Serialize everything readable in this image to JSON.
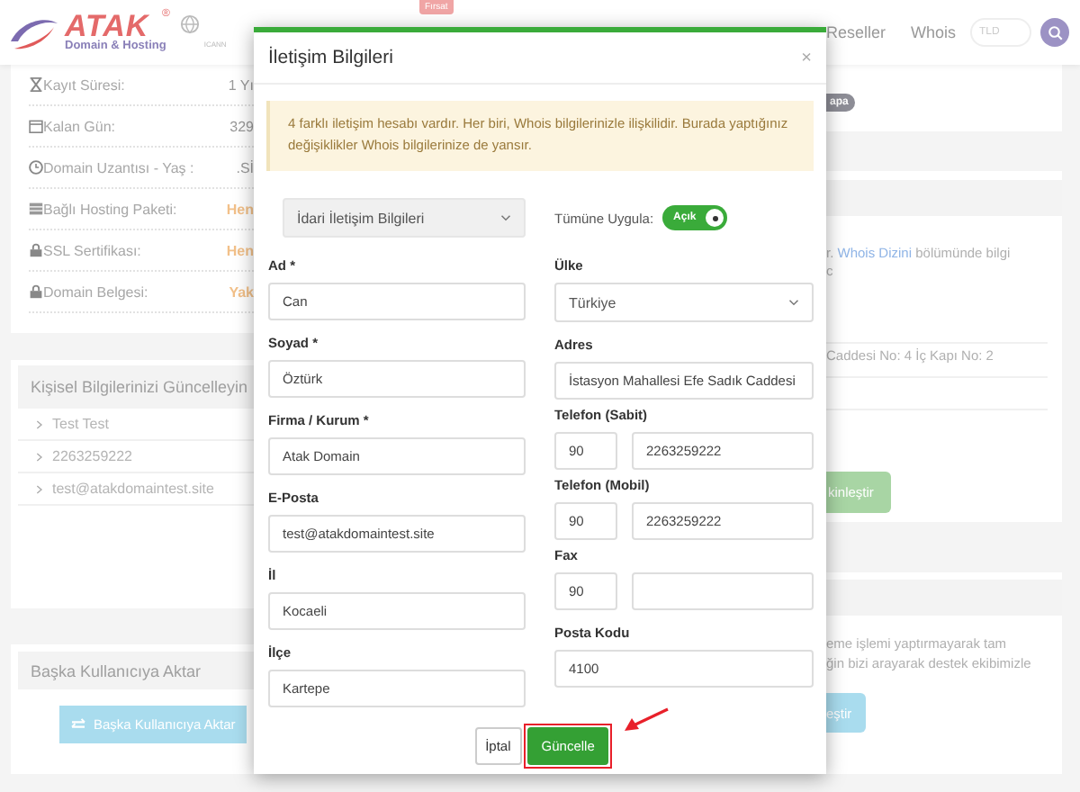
{
  "header": {
    "logo": {
      "brand": "ATAK",
      "registered": "®",
      "subtitle": "Domain & Hosting",
      "mark": "ICANN"
    },
    "promo_badge": "Fırsat",
    "nav": [
      "Reseller",
      "Whois"
    ],
    "tld_search": {
      "placeholder": "TLD"
    }
  },
  "domain_details": [
    {
      "kind": "hourglass",
      "label": "Kayıt Süresi:",
      "value": "1 Yı",
      "highlighted": false
    },
    {
      "kind": "calendar",
      "label": "Kalan Gün:",
      "value": "329",
      "highlighted": false
    },
    {
      "kind": "clock",
      "label": "Domain Uzantısı - Yaş :",
      "value": ".Sİ",
      "highlighted": false
    },
    {
      "kind": "server",
      "label": "Bağlı Hosting Paketi:",
      "value": "Hen",
      "highlighted": true
    },
    {
      "kind": "lock",
      "label": "SSL Sertifikası:",
      "value": "Hen",
      "highlighted": true
    },
    {
      "kind": "lock",
      "label": "Domain Belgesi:",
      "value": "Yak",
      "highlighted": true
    }
  ],
  "personal_info": {
    "title": "Kişisel Bilgilerinizi Güncelleyin",
    "items": [
      "Test Test",
      "2263259222",
      "test@atakdomaintest.site"
    ]
  },
  "transfer": {
    "title": "Başka Kullanıcıya Aktar",
    "button": "Başka Kullanıcıya Aktar"
  },
  "right_status_badge": "apa",
  "whois_panel": {
    "text_before": "r.",
    "link": "Whois Dizini",
    "text_after": "bölümünde bilgi",
    "line_2": "c",
    "address": "Caddesi No: 4 İç Kapı No: 2",
    "button": "kinleştir"
  },
  "support_panel": {
    "lines": [
      "eme işlemi yaptırmayarak tam",
      "ğin bizi arayarak destek ekibimizle"
    ],
    "button": "eştir"
  },
  "modal": {
    "title": "İletişim Bilgileri",
    "close": "×",
    "notice": "4 farklı iletişim hesabı vardır. Her biri, Whois bilgilerinizle ilişkilidir. Burada yaptığınız değişiklikler Whois bilgilerinize de yansır.",
    "contact_select": "İdari İletişim Bilgileri",
    "apply_all": {
      "label": "Tümüne Uygula:",
      "on": true,
      "state_text": "Açık"
    },
    "left_fields": [
      {
        "label": "Ad *",
        "kind": "text",
        "value": "Can"
      },
      {
        "label": "Soyad *",
        "kind": "text",
        "value": "Öztürk"
      },
      {
        "label": "Firma / Kurum *",
        "kind": "text",
        "value": "Atak Domain"
      },
      {
        "label": "E-Posta",
        "kind": "text",
        "value": "test@atakdomaintest.site"
      },
      {
        "label": "İl",
        "kind": "text",
        "value": "Kocaeli"
      },
      {
        "label": "İlçe",
        "kind": "text",
        "value": "Kartepe"
      }
    ],
    "right_fields": [
      {
        "label": "Ülke",
        "kind": "select",
        "value": "Türkiye"
      },
      {
        "label": "Adres",
        "kind": "text",
        "value": "İstasyon Mahallesi Efe Sadık Caddesi"
      },
      {
        "label": "Telefon (Sabit)",
        "kind": "phone",
        "code": "90",
        "value": "2263259222"
      },
      {
        "label": "Telefon (Mobil)",
        "kind": "phone",
        "code": "90",
        "value": "2263259222"
      },
      {
        "label": "Fax",
        "kind": "phone",
        "code": "90"
      },
      {
        "label": "Posta Kodu",
        "kind": "text",
        "value": "4100"
      }
    ],
    "buttons": {
      "cancel": "İptal",
      "submit": "Güncelle",
      "submit_highlighted": true
    }
  }
}
